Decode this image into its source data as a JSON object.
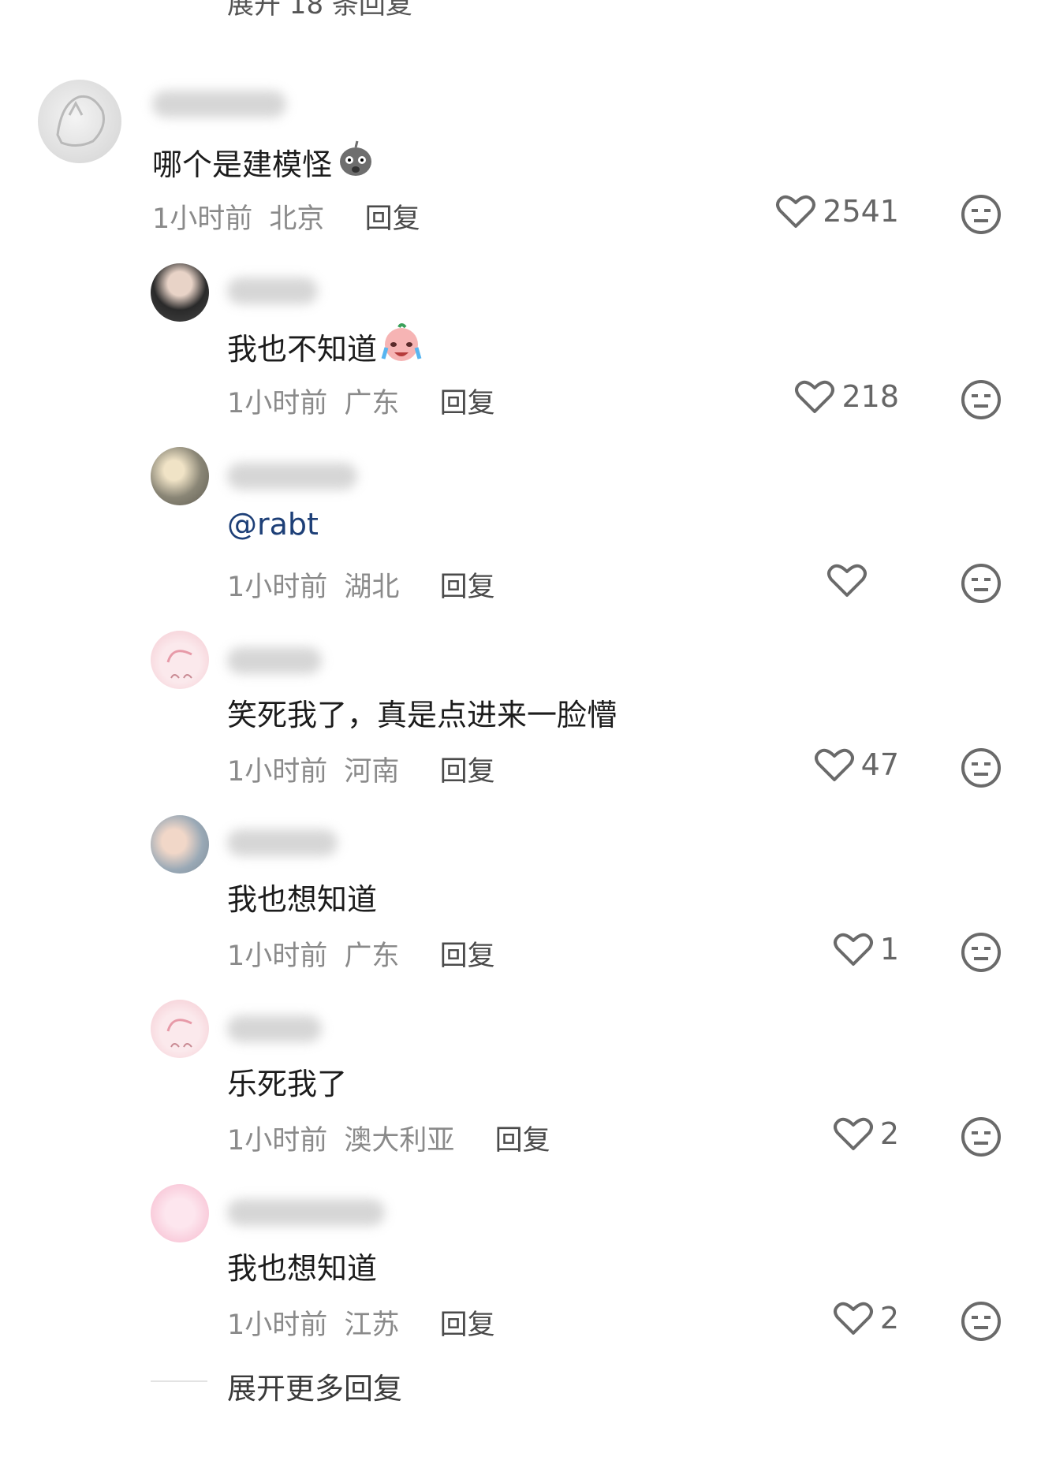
{
  "top_expand_label": "展开 18 条回复",
  "more_replies_label": "展开更多回复",
  "reply_label": "回复",
  "comments": [
    {
      "content": "哪个是建模怪",
      "time": "1小时前",
      "region": "北京",
      "likes": "2541"
    },
    {
      "content": "我也不知道",
      "time": "1小时前",
      "region": "广东",
      "likes": "218"
    },
    {
      "mention": "@rabt",
      "time": "1小时前",
      "region": "湖北",
      "likes": ""
    },
    {
      "content": "笑死我了，真是点进来一脸懵",
      "time": "1小时前",
      "region": "河南",
      "likes": "47"
    },
    {
      "content": "我也想知道",
      "time": "1小时前",
      "region": "广东",
      "likes": "1"
    },
    {
      "content": "乐死我了",
      "time": "1小时前",
      "region": "澳大利亚",
      "likes": "2"
    },
    {
      "content": "我也想知道",
      "time": "1小时前",
      "region": "江苏",
      "likes": "2"
    }
  ],
  "icons": {
    "like": "heart-outline-icon",
    "dislike": "neutral-face-icon"
  }
}
